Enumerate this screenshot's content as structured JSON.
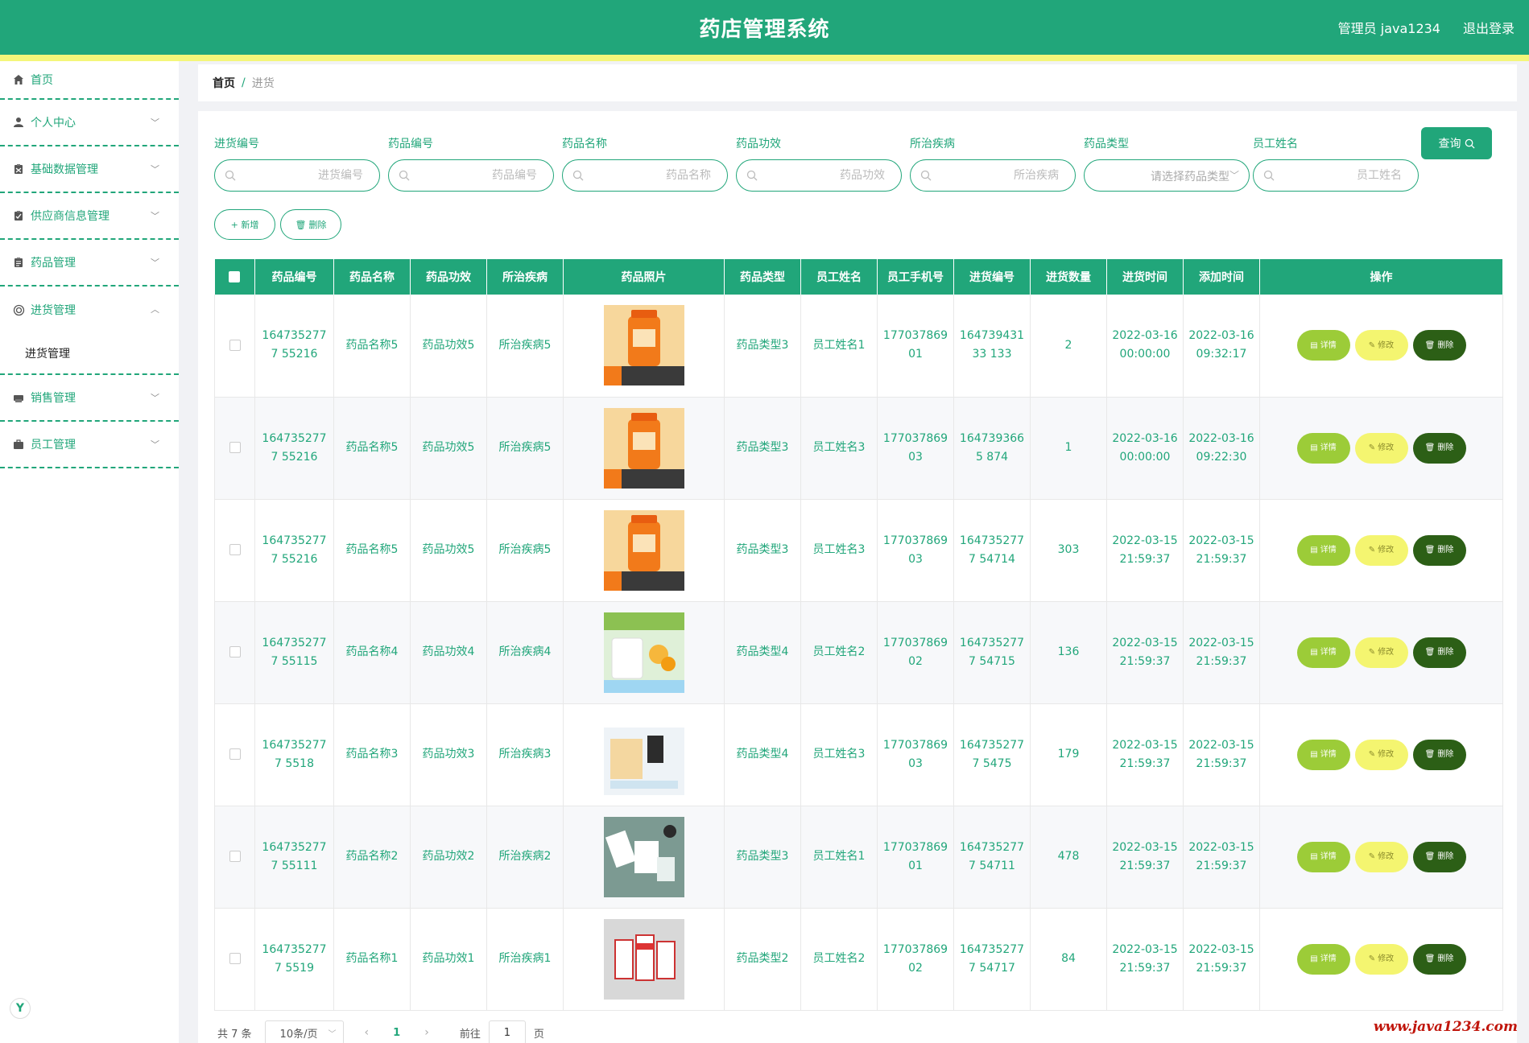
{
  "header": {
    "title": "药店管理系统",
    "admin": "管理员 java1234",
    "logout": "退出登录"
  },
  "sidebar": {
    "items": [
      {
        "label": "首页"
      },
      {
        "label": "个人中心"
      },
      {
        "label": "基础数据管理"
      },
      {
        "label": "供应商信息管理"
      },
      {
        "label": "药品管理"
      },
      {
        "label": "进货管理"
      },
      {
        "label": "销售管理"
      },
      {
        "label": "员工管理"
      }
    ],
    "sub_item": "进货管理"
  },
  "breadcrumb": {
    "home": "首页",
    "sep": "/",
    "current": "进货"
  },
  "filters": [
    {
      "label": "进货编号",
      "placeholder": "进货编号"
    },
    {
      "label": "药品编号",
      "placeholder": "药品编号"
    },
    {
      "label": "药品名称",
      "placeholder": "药品名称"
    },
    {
      "label": "药品功效",
      "placeholder": "药品功效"
    },
    {
      "label": "所治疾病",
      "placeholder": "所治疾病"
    },
    {
      "label": "药品类型",
      "placeholder": "请选择药品类型"
    },
    {
      "label": "员工姓名",
      "placeholder": "员工姓名"
    }
  ],
  "buttons": {
    "query": "查询",
    "add": "+ 新增",
    "delete": "删除"
  },
  "table": {
    "headers": [
      "药品编号",
      "药品名称",
      "药品功效",
      "所治疾病",
      "药品照片",
      "药品类型",
      "员工姓名",
      "员工手机号",
      "进货编号",
      "进货数量",
      "进货时间",
      "添加时间",
      "操作"
    ],
    "rows": [
      [
        "1647352777 55216",
        "药品名称5",
        "药品功效5",
        "所治疾病5",
        "",
        "药品类型3",
        "员工姓名1",
        "17703786901",
        "16473943133 133",
        "2",
        "2022-03-16 00:00:00",
        "2022-03-16 09:32:17"
      ],
      [
        "1647352777 55216",
        "药品名称5",
        "药品功效5",
        "所治疾病5",
        "",
        "药品类型3",
        "员工姓名3",
        "17703786903",
        "1647393665 874",
        "1",
        "2022-03-16 00:00:00",
        "2022-03-16 09:22:30"
      ],
      [
        "1647352777 55216",
        "药品名称5",
        "药品功效5",
        "所治疾病5",
        "",
        "药品类型3",
        "员工姓名3",
        "17703786903",
        "1647352777 54714",
        "303",
        "2022-03-15 21:59:37",
        "2022-03-15 21:59:37"
      ],
      [
        "1647352777 55115",
        "药品名称4",
        "药品功效4",
        "所治疾病4",
        "",
        "药品类型4",
        "员工姓名2",
        "17703786902",
        "1647352777 54715",
        "136",
        "2022-03-15 21:59:37",
        "2022-03-15 21:59:37"
      ],
      [
        "1647352777 5518",
        "药品名称3",
        "药品功效3",
        "所治疾病3",
        "",
        "药品类型4",
        "员工姓名3",
        "17703786903",
        "1647352777 5475",
        "179",
        "2022-03-15 21:59:37",
        "2022-03-15 21:59:37"
      ],
      [
        "1647352777 55111",
        "药品名称2",
        "药品功效2",
        "所治疾病2",
        "",
        "药品类型3",
        "员工姓名1",
        "17703786901",
        "1647352777 54711",
        "478",
        "2022-03-15 21:59:37",
        "2022-03-15 21:59:37"
      ],
      [
        "1647352777 5519",
        "药品名称1",
        "药品功效1",
        "所治疾病1",
        "",
        "药品类型2",
        "员工姓名2",
        "17703786902",
        "1647352777 54717",
        "84",
        "2022-03-15 21:59:37",
        "2022-03-15 21:59:37"
      ]
    ],
    "row_ops": {
      "detail": "详情",
      "edit": "修改",
      "delete": "删除"
    }
  },
  "pagination": {
    "total": "共 7 条",
    "size": "10条/页",
    "prev": "‹",
    "page": "1",
    "next": "›",
    "goto": "前往",
    "goto_value": "1",
    "unit": "页"
  },
  "watermark": "www.java1234.com",
  "colors": {
    "primary": "#21a67a",
    "stripe": "#f4f67a",
    "detail": "#9ccc38",
    "edit": "#f4f570",
    "delete": "#2c5f16"
  }
}
